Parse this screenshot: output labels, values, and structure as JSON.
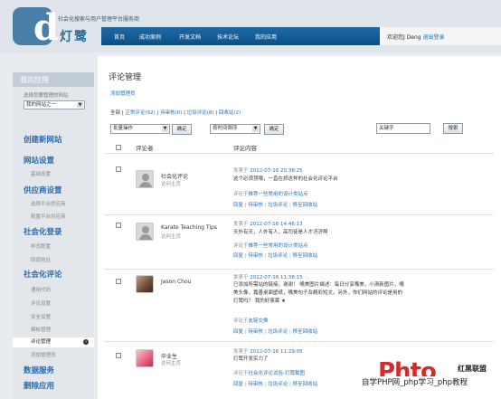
{
  "header": {
    "logo_letter": "d",
    "slogan": "社会化搜索与用户管理平台服务商",
    "brand": "灯鹭",
    "nav": [
      "首页",
      "成功案例",
      "开发文档",
      "技术论坛",
      "我的应用"
    ],
    "welcome": "欢迎您J Deng",
    "logout": "退出登录"
  },
  "sidebar": {
    "title": "我的应用",
    "hint": "选择您要管理的网站",
    "site_select": "我的网站之一",
    "groups": [
      {
        "label": "创建新网站",
        "items": []
      },
      {
        "label": "网站设置",
        "items": [
          "基础设置"
        ]
      },
      {
        "label": "供应商设置",
        "items": [
          "选择平台供应商",
          "配置平台供应商"
        ]
      },
      {
        "label": "社会化登录",
        "items": [
          "样式配置",
          "回调地址"
        ]
      },
      {
        "label": "社会化评论",
        "items": [
          "通用代码",
          "评论设置",
          "安全设置",
          "模板管理",
          "评论管理",
          "添加管理员"
        ]
      },
      {
        "label": "数据服务",
        "items": []
      },
      {
        "label": "删除应用",
        "items": []
      }
    ],
    "active_item": "评论管理"
  },
  "main": {
    "title": "评论管理",
    "add_admin": "添加管理员",
    "filter": {
      "all": "全部",
      "normal": "正常评论(92)",
      "pending": "待审核(0)",
      "spam": "垃圾评论(8)",
      "trash": "回收站(2)"
    },
    "bulk_select": "批量操作",
    "confirm": "确定",
    "sort_select": "按时间倒序",
    "keyword_placeholder": "关键字",
    "search": "搜索",
    "col_commenter": "评论者",
    "col_content": "评论内容"
  },
  "comments": [
    {
      "name": "社会化评论",
      "home": "访问主页",
      "time_prefix": "发表于",
      "time": "2012-07-16 20:38:25",
      "text": "这个必须顶哦，一直在抓这样的社会化评论平台",
      "ref_prefix": "评论于",
      "ref": "推荐一些常用的设计类站点",
      "actions": [
        "回复",
        "待审核",
        "垃圾评论",
        "移至回收站"
      ]
    },
    {
      "name": "Karate Teaching Tips",
      "home": "访问主页",
      "time_prefix": "发表于",
      "time": "2012-07-16 14:46:13",
      "text": "天外有天，人外有人，高司徒是人才济济啊",
      "ref_prefix": "评论于",
      "ref": "推荐一些常用的设计类站点",
      "actions": [
        "回复",
        "待审核",
        "垃圾评论",
        "移至回收站"
      ]
    },
    {
      "name": "Jason Chou",
      "home": "",
      "time_prefix": "发表于",
      "time": "2012-07-16 11:38:15",
      "text": "已添加所需站的链接，谢谢！ 嘴美图片描述：每日分享嘴美，小清新图片，嘴美头像，嘉善桌面壁纸，嘴美句子及精彩短文。另外，你们网站的评论是用的灯鹭吗？ 我的好羡慕 ★",
      "ref_prefix": "评论于",
      "ref": "友链交换",
      "actions": [
        "回复",
        "待审核",
        "垃圾评论",
        "移至回收站"
      ]
    },
    {
      "name": "毕业生",
      "home": "访问主页",
      "time_prefix": "发表于",
      "time": "2012-07-16 11:29:05",
      "text": "灯鹭开发实力了",
      "ref_prefix": "评论于",
      "ref": "社会化评论试验-灯鹭截图",
      "actions": [
        "回复",
        "待审核",
        "垃圾评论",
        "移至回收站"
      ]
    }
  ],
  "watermark": {
    "logo": "Phto",
    "cn": "红黑联盟",
    "bar": "自学PHP网_php学习_php教程"
  }
}
